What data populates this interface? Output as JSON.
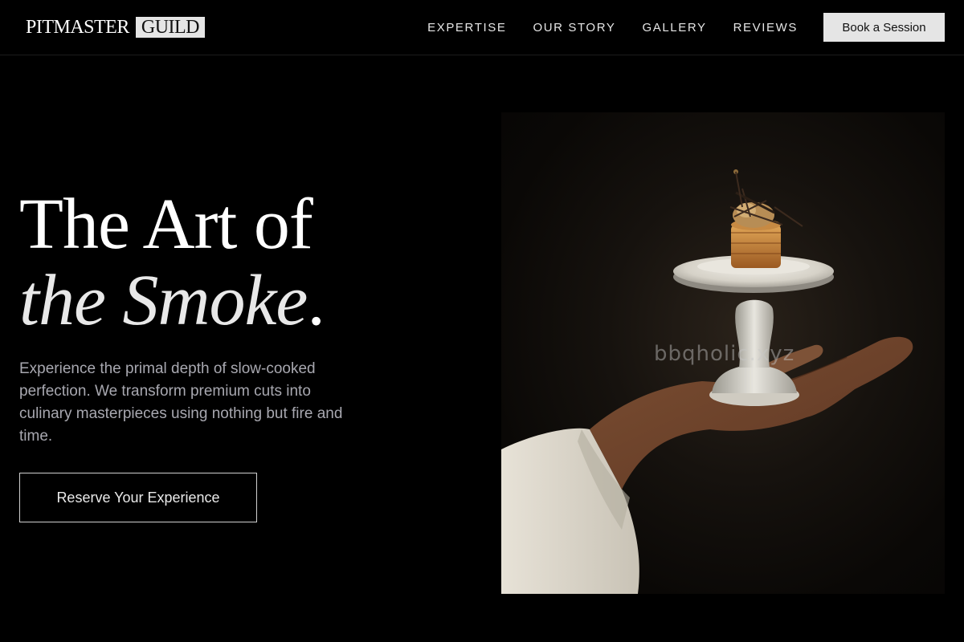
{
  "header": {
    "logo": {
      "main": "PITMASTER",
      "box": "GUILD"
    },
    "nav": [
      {
        "label": "EXPERTISE"
      },
      {
        "label": "OUR STORY"
      },
      {
        "label": "GALLERY"
      },
      {
        "label": "REVIEWS"
      }
    ],
    "book_button": "Book a Session"
  },
  "hero": {
    "title_line1": "The Art of",
    "title_line2_italic": "the Smoke",
    "title_line2_end": ".",
    "description": "Experience the primal depth of slow-cooked perfection. We transform premium cuts into culinary masterpieces using nothing but fire and time.",
    "cta": "Reserve Your Experience"
  },
  "image": {
    "watermark": "bbqholic.xyz"
  },
  "colors": {
    "background": "#000000",
    "button_bg": "#e5e5e5",
    "text_muted": "#a8a8b0"
  }
}
